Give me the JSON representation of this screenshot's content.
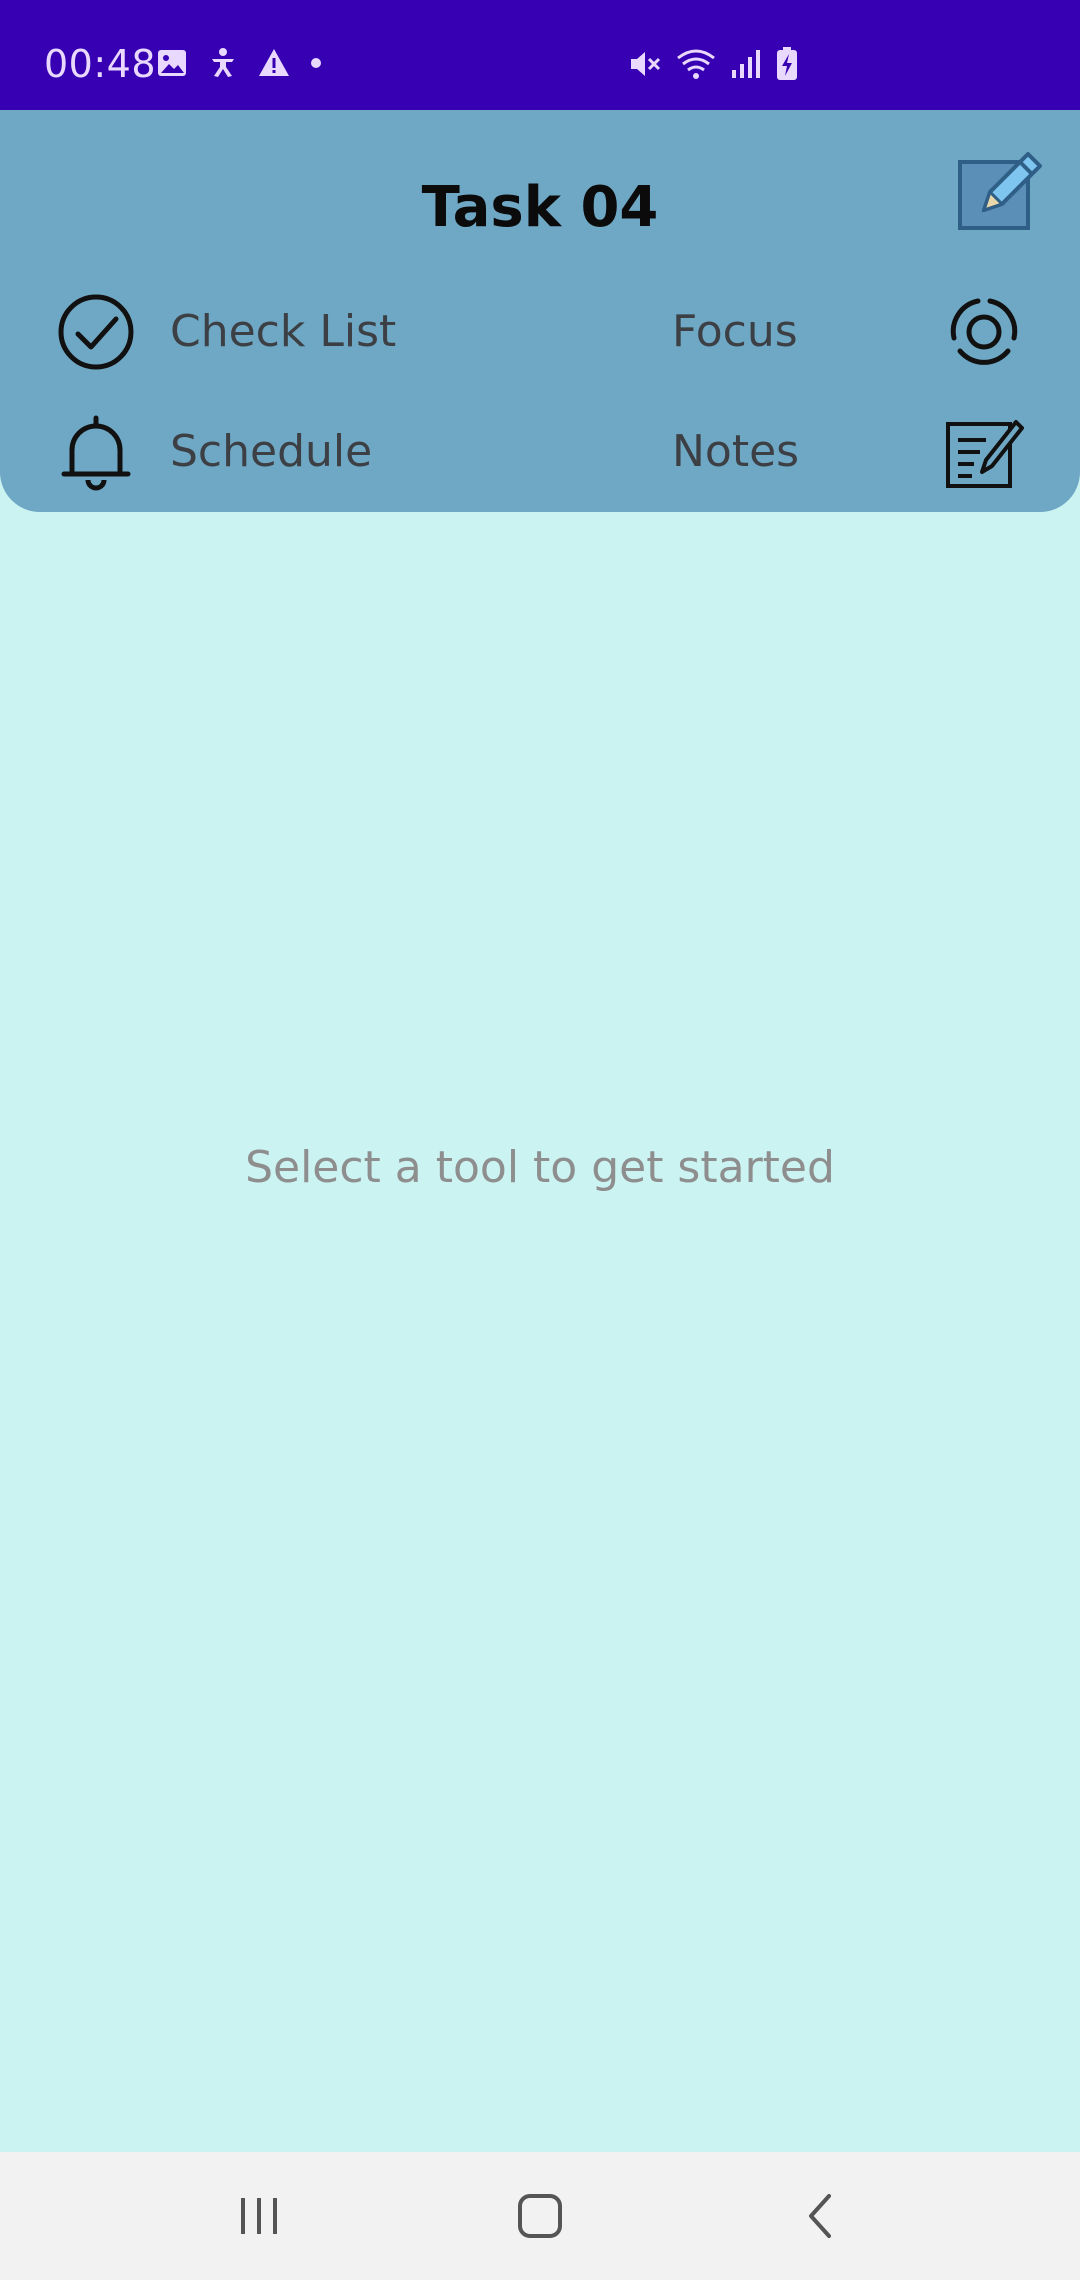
{
  "status_bar": {
    "time": "00:48",
    "left_icons": [
      "image-icon",
      "accessibility-icon",
      "warning-icon",
      "dot-icon"
    ],
    "right_icons": [
      "mute-icon",
      "wifi-icon",
      "signal-icon",
      "battery-charging-icon"
    ],
    "background": "#3700B3"
  },
  "header": {
    "title": "Task 04",
    "background": "#6FA8C5",
    "edit_icon": "pencil-square-icon"
  },
  "tools": {
    "check_list": {
      "label": "Check List",
      "icon": "check-circle-icon"
    },
    "focus": {
      "label": "Focus",
      "icon": "focus-target-icon"
    },
    "schedule": {
      "label": "Schedule",
      "icon": "bell-icon"
    },
    "notes": {
      "label": "Notes",
      "icon": "note-edit-icon"
    }
  },
  "main": {
    "placeholder": "Select a tool to get started",
    "background": "#CBF3F2"
  },
  "nav_bar": {
    "buttons": [
      "recents-icon",
      "home-icon",
      "back-icon"
    ]
  }
}
